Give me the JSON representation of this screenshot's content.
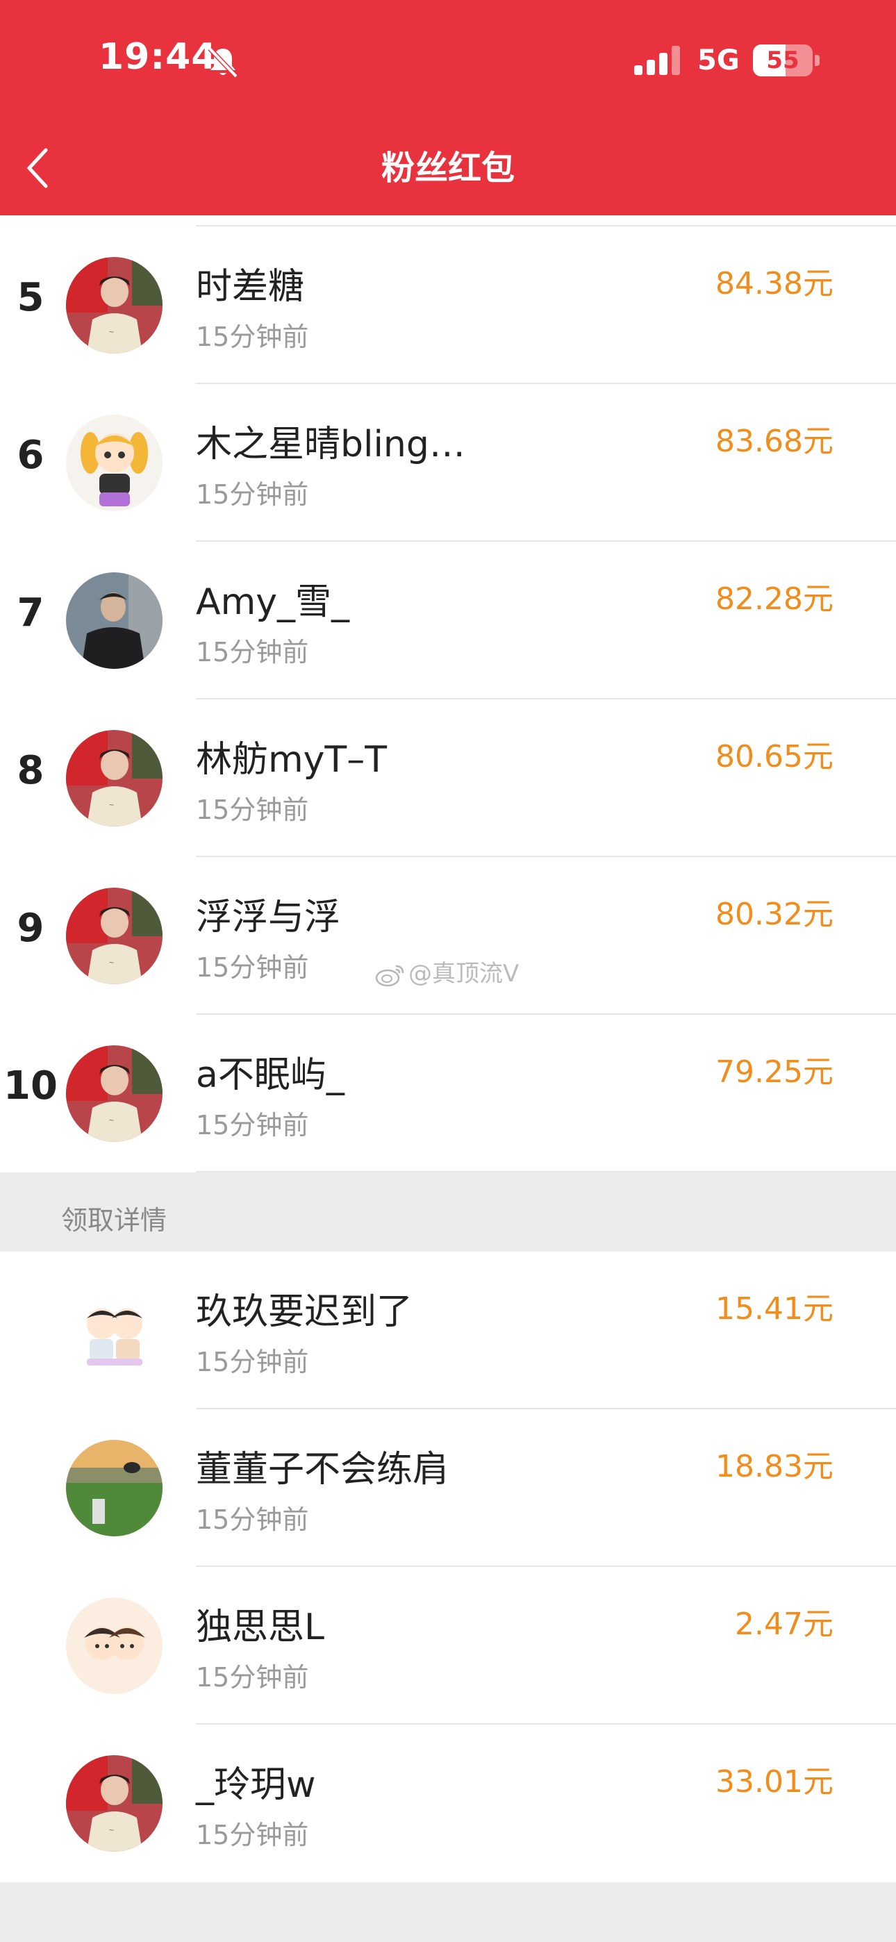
{
  "status_bar": {
    "time": "19:44",
    "network": "5G",
    "battery_level": "55",
    "battery_fraction": 0.55
  },
  "nav": {
    "title": "粉丝红包",
    "back_icon": "chevron-left-icon"
  },
  "ranking": [
    {
      "rank": "5",
      "name": "时差糖",
      "time": "15分钟前",
      "amount": "84.38元"
    },
    {
      "rank": "6",
      "name": "木之星晴bling…",
      "time": "15分钟前",
      "amount": "83.68元"
    },
    {
      "rank": "7",
      "name": "Amy_雪_",
      "time": "15分钟前",
      "amount": "82.28元"
    },
    {
      "rank": "8",
      "name": "林舫myT–T",
      "time": "15分钟前",
      "amount": "80.65元"
    },
    {
      "rank": "9",
      "name": "浮浮与浮",
      "time": "15分钟前",
      "amount": "80.32元"
    },
    {
      "rank": "10",
      "name": "a不眠屿_",
      "time": "15分钟前",
      "amount": "79.25元"
    }
  ],
  "details_section": {
    "label": "领取详情"
  },
  "details": [
    {
      "name": "玖玖要迟到了",
      "time": "15分钟前",
      "amount": "15.41元"
    },
    {
      "name": "董董子不会练肩",
      "time": "15分钟前",
      "amount": "18.83元"
    },
    {
      "name": "独思思L",
      "time": "15分钟前",
      "amount": "2.47元"
    },
    {
      "name": "_玲玥w",
      "time": "15分钟前",
      "amount": "33.01元"
    }
  ],
  "watermark": {
    "text": "@真顶流V"
  },
  "colors": {
    "header": "#e8333f",
    "amount": "#f28c1b",
    "background": "#ececec"
  }
}
